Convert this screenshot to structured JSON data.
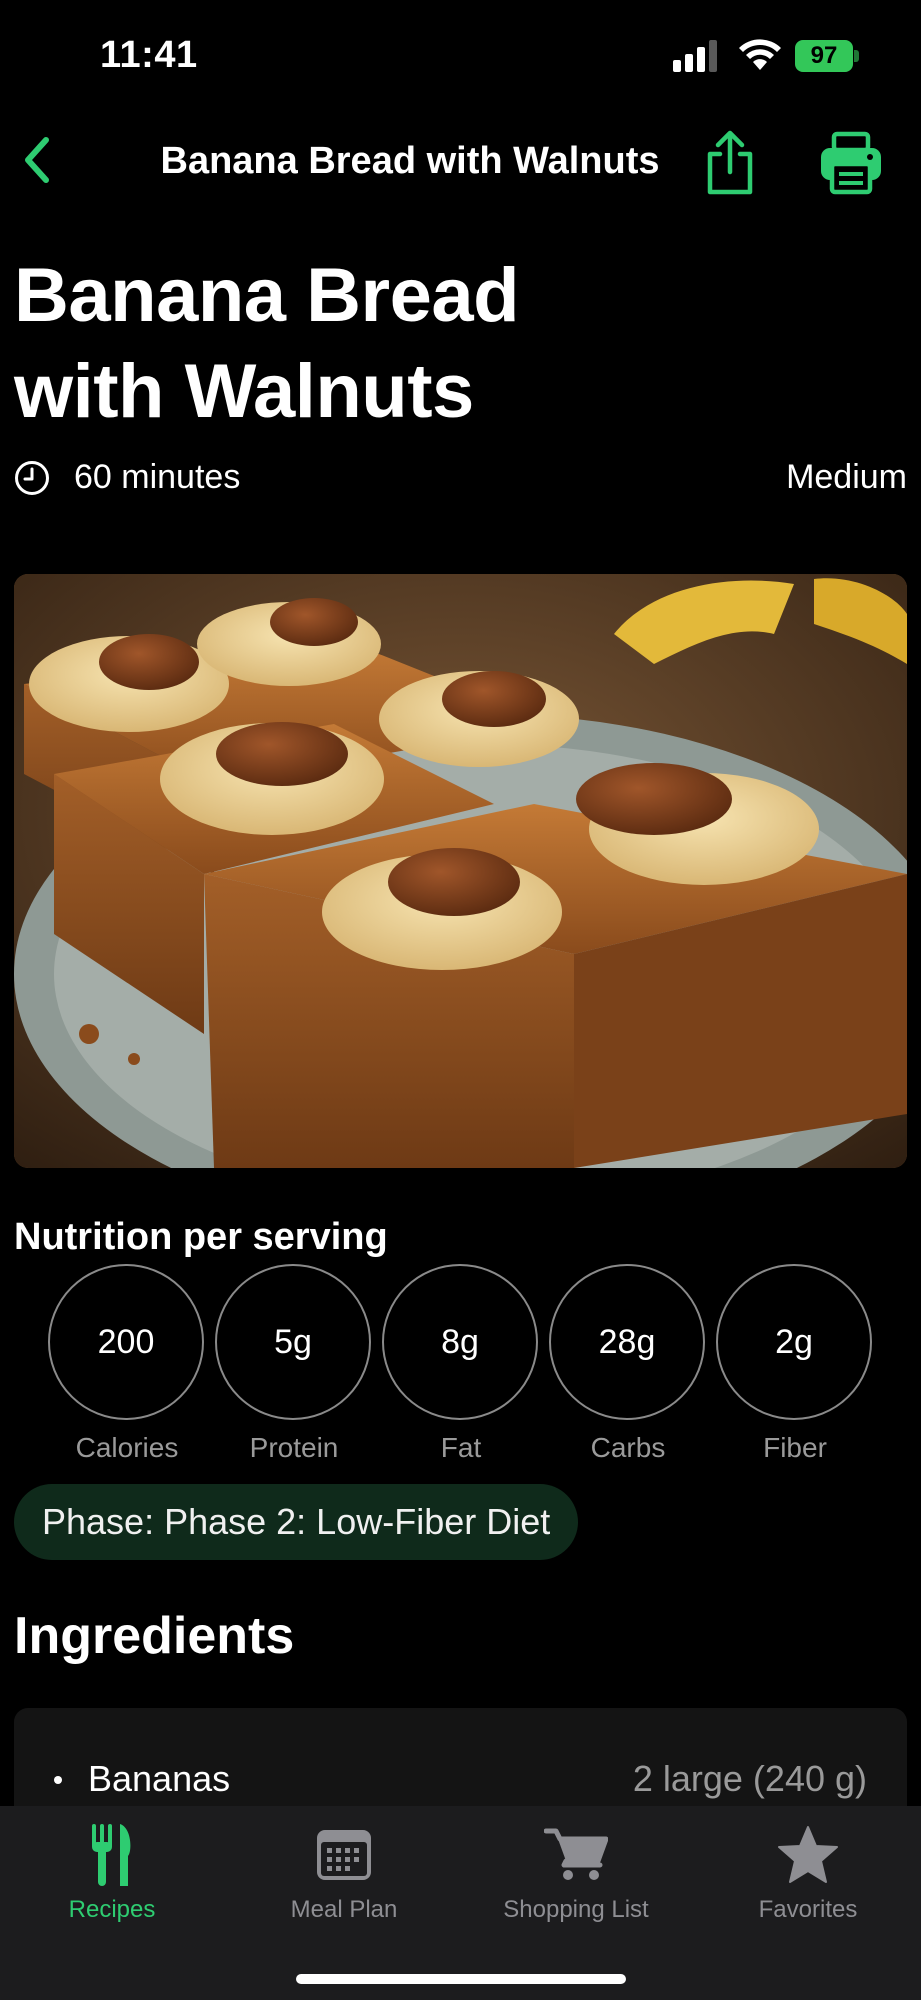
{
  "status_bar": {
    "time": "11:41",
    "battery": "97"
  },
  "nav": {
    "title": "Banana Bread with Walnuts"
  },
  "recipe": {
    "title_line1": "Banana Bread",
    "title_line2": "with Walnuts",
    "duration": "60 minutes",
    "difficulty": "Medium"
  },
  "nutrition": {
    "heading": "Nutrition per serving",
    "items": [
      {
        "value": "200",
        "label": "Calories"
      },
      {
        "value": "5g",
        "label": "Protein"
      },
      {
        "value": "8g",
        "label": "Fat"
      },
      {
        "value": "28g",
        "label": "Carbs"
      },
      {
        "value": "2g",
        "label": "Fiber"
      }
    ]
  },
  "phase": {
    "text": "Phase: Phase 2: Low-Fiber Diet"
  },
  "ingredients": {
    "heading": "Ingredients",
    "items": [
      {
        "name": "Bananas",
        "quantity": "2 large (240 g)"
      }
    ]
  },
  "tab_bar": {
    "tabs": [
      {
        "label": "Recipes",
        "icon": "fork-knife-icon",
        "active": true
      },
      {
        "label": "Meal Plan",
        "icon": "calendar-icon",
        "active": false
      },
      {
        "label": "Shopping List",
        "icon": "cart-icon",
        "active": false
      },
      {
        "label": "Favorites",
        "icon": "star-icon",
        "active": false
      }
    ]
  },
  "colors": {
    "accent": "#2ecc71",
    "phase_bg": "#0f2a1b",
    "tab_bg": "#1c1c1e"
  }
}
